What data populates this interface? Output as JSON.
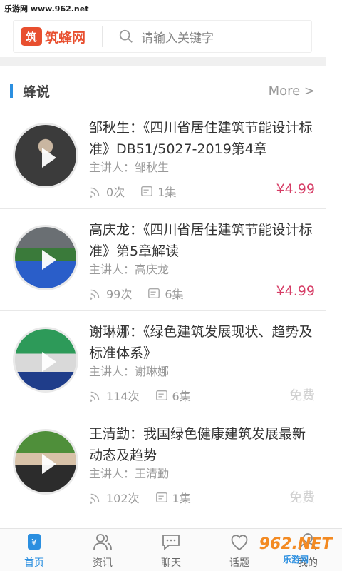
{
  "watermark_top": "乐游网 www.962.net",
  "header": {
    "logo_mark": "筑",
    "logo_text": "筑蜂网",
    "search_placeholder": "请输入关键字"
  },
  "section": {
    "title": "蜂说",
    "more": "More >"
  },
  "items": [
    {
      "title": "邹秋生：《四川省居住建筑节能设计标准》DB51/5027-2019第4章",
      "speaker": "主讲人：邹秋生",
      "plays": "0次",
      "episodes": "1集",
      "price": "¥4.99",
      "free": false
    },
    {
      "title": "高庆龙：《四川省居住建筑节能设计标准》第5章解读",
      "speaker": "主讲人：高庆龙",
      "plays": "99次",
      "episodes": "6集",
      "price": "¥4.99",
      "free": false
    },
    {
      "title": "谢琳娜：《绿色建筑发展现状、趋势及标准体系》",
      "speaker": "主讲人：谢琳娜",
      "plays": "114次",
      "episodes": "6集",
      "price": "免费",
      "free": true
    },
    {
      "title": "王清勤：我国绿色健康建筑发展最新动态及趋势",
      "speaker": "主讲人：王清勤",
      "plays": "102次",
      "episodes": "1集",
      "price": "免费",
      "free": true
    }
  ],
  "tabs": [
    {
      "label": "首页",
      "icon": "home-icon",
      "active": true
    },
    {
      "label": "资讯",
      "icon": "people-icon",
      "active": false
    },
    {
      "label": "聊天",
      "icon": "chat-icon",
      "active": false
    },
    {
      "label": "话题",
      "icon": "heart-icon",
      "active": false
    },
    {
      "label": "我的",
      "icon": "user-icon",
      "active": false
    }
  ],
  "watermark_bottom": {
    "big": "962.NET",
    "small": "乐游网"
  },
  "colors": {
    "accent": "#2b8fe0",
    "brand": "#e84f2f",
    "price": "#d63d66"
  }
}
